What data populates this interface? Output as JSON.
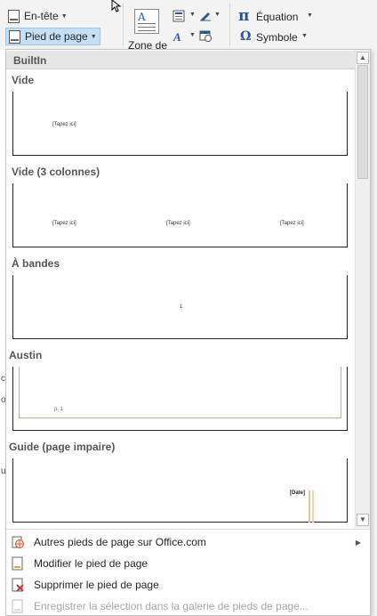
{
  "ribbon": {
    "header_label": "En-tête",
    "footer_label": "Pied de page",
    "zone_label": "Zone de",
    "equation_label": "Équation",
    "symbol_label": "Symbole"
  },
  "gallery": {
    "section_label": "BuiltIn",
    "items": [
      {
        "title": "Vide",
        "texts": [
          "[Tapez ici]"
        ]
      },
      {
        "title": "Vide (3 colonnes)",
        "texts": [
          "[Tapez ici]",
          "[Tapez ici]",
          "[Tapez ici]"
        ]
      },
      {
        "title": "À bandes",
        "texts": [
          "1"
        ]
      },
      {
        "title": "Austin",
        "texts": [
          "p. 1"
        ]
      },
      {
        "title": "Guide (page impaire)",
        "texts": [
          "[Date]"
        ]
      }
    ]
  },
  "menu": {
    "more": "Autres pieds de page sur Office.com",
    "edit": "Modifier le pied de page",
    "remove": "Supprimer le pied de page",
    "save": "Enregistrer la sélection dans la galerie de pieds de page..."
  },
  "doc_marks": [
    "c",
    "o",
    "u"
  ],
  "icons": {
    "header": "header-icon",
    "footer": "footer-icon",
    "textbox": "text-box-icon",
    "equation": "pi-icon",
    "symbol": "omega-icon",
    "more": "office-globe-icon",
    "edit": "page-edit-icon",
    "remove": "delete-footer-icon"
  },
  "colors": {
    "accent": "#2b579a",
    "active_button": "#c5dff5",
    "remove_icon": "#d13438"
  }
}
